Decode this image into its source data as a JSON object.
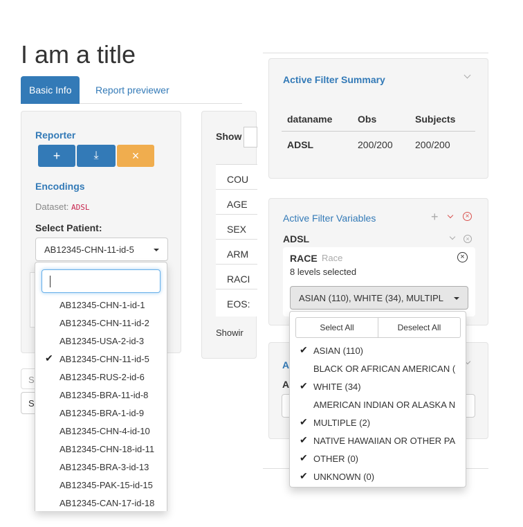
{
  "page": {
    "title": "I am a title"
  },
  "tabs": [
    {
      "label": "Basic Info"
    },
    {
      "label": "Report previewer"
    }
  ],
  "reporter": {
    "heading": "Reporter",
    "add_label": "+",
    "download_label": "⤓",
    "clear_label": "×",
    "encodings_heading": "Encodings",
    "dataset_label": "Dataset:",
    "dataset_value": "ADSL",
    "select_patient_label": "Select Patient:",
    "selected_patient": "AB12345-CHN-11-id-5",
    "search_placeholder": "",
    "patients": [
      "AB12345-CHN-1-id-1",
      "AB12345-CHN-11-id-2",
      "AB12345-USA-2-id-3",
      "AB12345-CHN-11-id-5",
      "AB12345-RUS-2-id-6",
      "AB12345-BRA-11-id-8",
      "AB12345-BRA-1-id-9",
      "AB12345-CHN-4-id-10",
      "AB12345-CHN-18-id-11",
      "AB12345-BRA-3-id-13",
      "AB12345-PAK-15-id-15",
      "AB12345-CAN-17-id-18"
    ],
    "checked_index": 3
  },
  "bg_left": {
    "s1": "S",
    "s2": "S"
  },
  "middle": {
    "show_label": "Show",
    "rows": [
      "COU",
      "AGE",
      "SEX",
      "ARM",
      "RACI",
      "EOS:"
    ],
    "footer": "Showir"
  },
  "summary": {
    "title": "Active Filter Summary",
    "columns": [
      "dataname",
      "Obs",
      "Subjects"
    ],
    "row": {
      "dataname": "ADSL",
      "obs": "200/200",
      "subjects": "200/200"
    }
  },
  "filter_vars": {
    "title": "Active Filter Variables",
    "dataset": "ADSL",
    "var_name": "RACE",
    "var_label": "Race",
    "levels_text": "8 levels selected",
    "selected_display": "ASIAN (110), WHITE (34), MULTIPL",
    "select_all": "Select All",
    "deselect_all": "Deselect All",
    "options": [
      {
        "label": "ASIAN (110)",
        "checked": true
      },
      {
        "label": "BLACK OR AFRICAN AMERICAN (",
        "checked": false
      },
      {
        "label": "WHITE (34)",
        "checked": true
      },
      {
        "label": "AMERICAN INDIAN OR ALASKA N",
        "checked": false
      },
      {
        "label": "MULTIPLE (2)",
        "checked": true
      },
      {
        "label": "NATIVE HAWAIIAN OR OTHER PA",
        "checked": true
      },
      {
        "label": "OTHER (0)",
        "checked": true
      },
      {
        "label": "UNKNOWN (0)",
        "checked": true
      }
    ]
  },
  "bg_right": {
    "a1": "A",
    "a2": "A"
  },
  "colors": {
    "primary": "#337ab7",
    "warning": "#f0ad4e"
  }
}
